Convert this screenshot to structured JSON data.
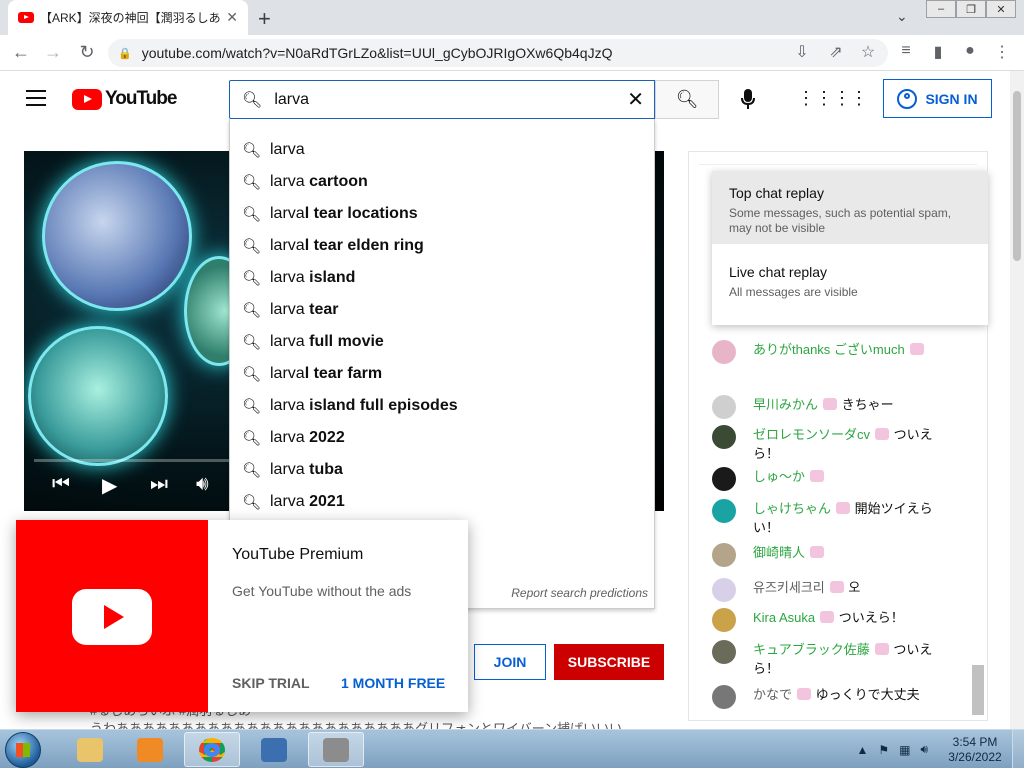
{
  "browser": {
    "tab_title": "【ARK】深夜の神回【潤羽るしあ/ホロ",
    "tab_close": "✕",
    "new_tab": "+",
    "url": "youtube.com/watch?v=N0aRdTGrLZo&list=UUl_gCybOJRIgOXw6Qb4qJzQ"
  },
  "header": {
    "logo_text": "YouTube",
    "search_value": "larva",
    "signin_label": "SIGN IN"
  },
  "suggestions": {
    "items": [
      {
        "prefix": "larva",
        "rest": ""
      },
      {
        "prefix": "larva",
        "rest": " cartoon"
      },
      {
        "prefix": "larva",
        "rest": "l tear locations"
      },
      {
        "prefix": "larva",
        "rest": "l tear elden ring"
      },
      {
        "prefix": "larva",
        "rest": " island"
      },
      {
        "prefix": "larva",
        "rest": " tear"
      },
      {
        "prefix": "larva",
        "rest": " full movie"
      },
      {
        "prefix": "larva",
        "rest": "l tear farm"
      },
      {
        "prefix": "larva",
        "rest": " island full episodes"
      },
      {
        "prefix": "larva",
        "rest": " 2022"
      },
      {
        "prefix": "larva",
        "rest": " tuba"
      },
      {
        "prefix": "larva",
        "rest": " 2021"
      }
    ],
    "report_link": "Report search predictions"
  },
  "premium": {
    "title": "YouTube Premium",
    "subtitle": "Get YouTube without the ads",
    "skip_label": "SKIP TRIAL",
    "free_label": "1 MONTH FREE"
  },
  "channel_actions": {
    "join_label": "JOIN",
    "subscribe_label": "SUBSCRIBE"
  },
  "description": {
    "line1": "#るしあらいぶ #潤羽るしあ",
    "line2": "うわあああああああああああああああああああああああグリフォンとワイバーン捕ばいいい"
  },
  "chat_menu": {
    "top_title": "Top chat replay",
    "top_desc": "Some messages, such as potential spam, may not be visible",
    "live_title": "Live chat replay",
    "live_desc": "All messages are visible"
  },
  "chat_messages": [
    {
      "author": "ありがthanks ございmuch",
      "text": "",
      "author_color": "#2ba640",
      "avatar_color": "#e8b4c8"
    },
    {
      "author": "早川みかん",
      "text": "きちゃー",
      "author_color": "#2ba640",
      "avatar_color": "#cfcfcf"
    },
    {
      "author": "ゼロレモンソーダcv",
      "text": "ついえら！",
      "author_color": "#2ba640",
      "avatar_color": "#3a4a35"
    },
    {
      "author": "しゅ～か",
      "text": "",
      "author_color": "#2ba640",
      "avatar_color": "#1a1a1a"
    },
    {
      "author": "しゃけちゃん",
      "text": "開始ツイえらい！",
      "author_color": "#2ba640",
      "avatar_color": "#1aa3a3"
    },
    {
      "author": "御崎晴人",
      "text": "",
      "author_color": "#2ba640",
      "avatar_color": "#b3a48a"
    },
    {
      "author": "유즈키세크리",
      "text": "오",
      "author_color": "#606060",
      "avatar_color": "#d8d0e8"
    },
    {
      "author": "Kira Asuka",
      "text": "ついえら！",
      "author_color": "#2ba640",
      "avatar_color": "#c9a24a"
    },
    {
      "author": "キュアブラック佐藤",
      "text": "ついえら！",
      "author_color": "#2ba640",
      "avatar_color": "#6b6b5a"
    },
    {
      "author": "かなで",
      "text": "ゆっくりで大丈夫",
      "author_color": "#606060",
      "avatar_color": "#777777"
    }
  ],
  "taskbar": {
    "time": "3:54 PM",
    "date": "3/26/2022"
  },
  "colors": {
    "youtube_red": "#ff0000",
    "link_blue": "#065fd4",
    "subscribe_red": "#cc0000",
    "member_green": "#2ba640"
  }
}
